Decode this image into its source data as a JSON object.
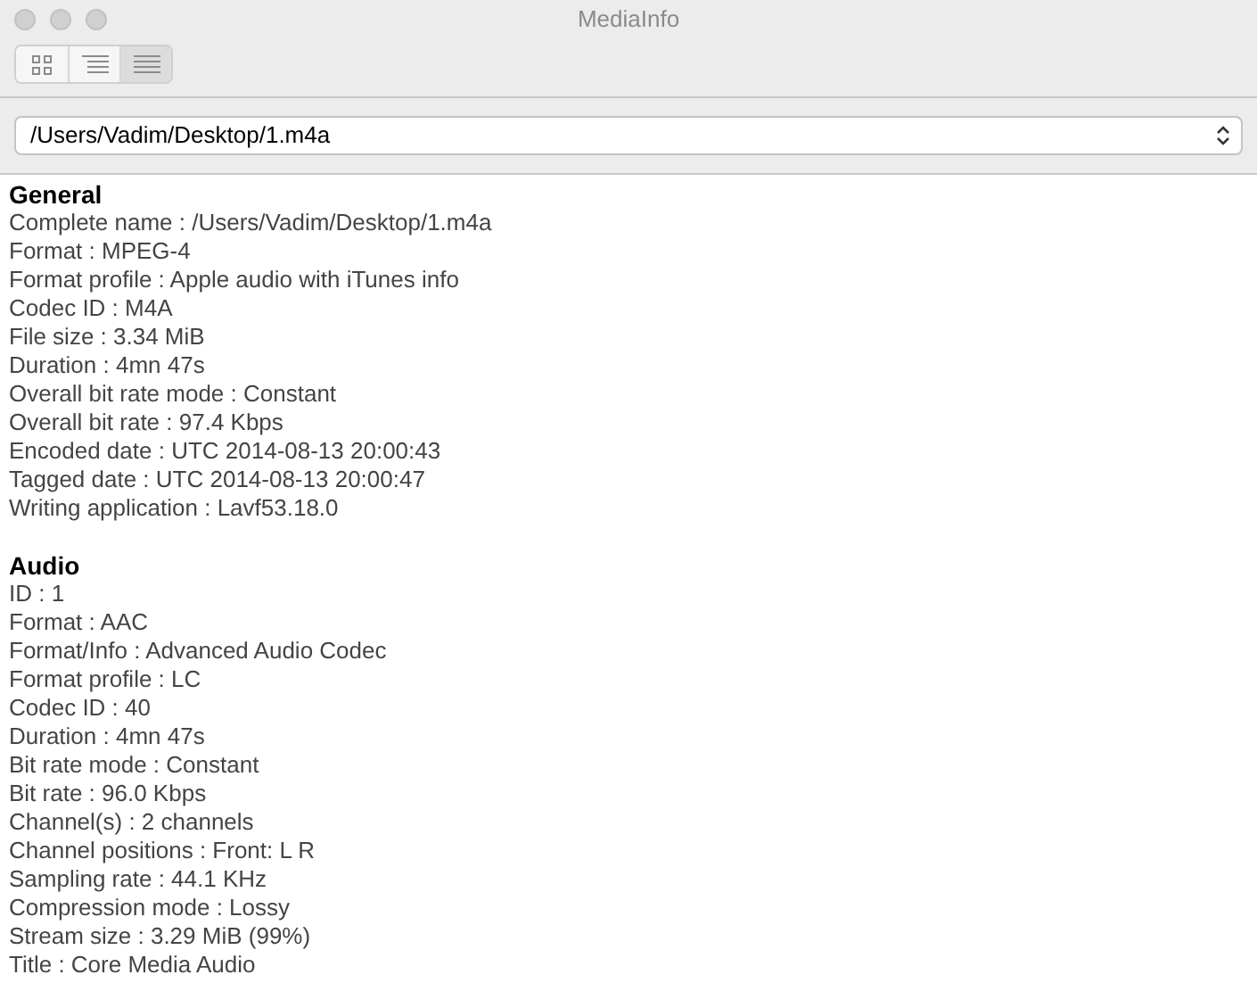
{
  "window": {
    "title": "MediaInfo"
  },
  "view_modes": [
    {
      "kind": "grid",
      "selected": false
    },
    {
      "kind": "tree",
      "selected": false
    },
    {
      "kind": "text",
      "selected": true
    }
  ],
  "file_selector": {
    "value": "/Users/Vadim/Desktop/1.m4a"
  },
  "sections": [
    {
      "title": "General",
      "lines": [
        "Complete name : /Users/Vadim/Desktop/1.m4a",
        "Format : MPEG-4",
        "Format profile : Apple audio with iTunes info",
        "Codec ID : M4A",
        "File size : 3.34 MiB",
        "Duration : 4mn 47s",
        "Overall bit rate mode : Constant",
        "Overall bit rate : 97.4 Kbps",
        "Encoded date : UTC 2014-08-13 20:00:43",
        "Tagged date : UTC 2014-08-13 20:00:47",
        "Writing application : Lavf53.18.0"
      ]
    },
    {
      "title": "Audio",
      "lines": [
        "ID : 1",
        "Format : AAC",
        "Format/Info : Advanced Audio Codec",
        "Format profile : LC",
        "Codec ID : 40",
        "Duration : 4mn 47s",
        "Bit rate mode : Constant",
        "Bit rate : 96.0 Kbps",
        "Channel(s) : 2 channels",
        "Channel positions : Front: L R",
        "Sampling rate : 44.1 KHz",
        "Compression mode : Lossy",
        "Stream size : 3.29 MiB (99%)",
        "Title : Core Media Audio"
      ]
    }
  ]
}
